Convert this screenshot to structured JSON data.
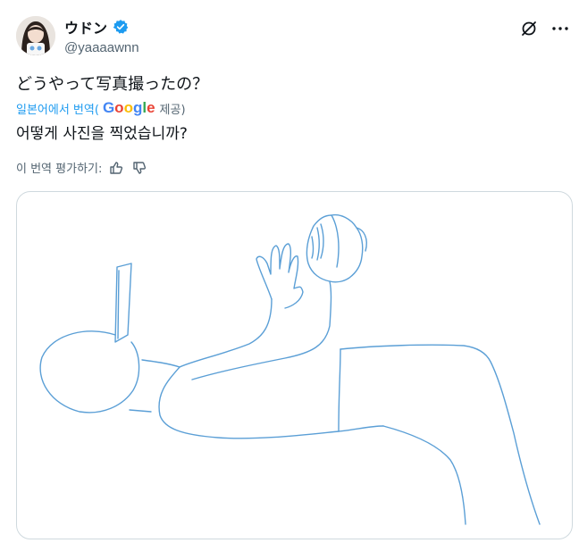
{
  "author": {
    "display_name": "ウドン",
    "handle": "@yaaaawnn",
    "verified": true
  },
  "tweet": {
    "text": "どうやって写真撮ったの？"
  },
  "translation": {
    "prefix": "일본어에서 번역(",
    "google_letters": [
      "G",
      "o",
      "o",
      "g",
      "l",
      "e"
    ],
    "suffix": " 제공)",
    "translated_text": "어떻게 사진을 찍었습니까?"
  },
  "rating": {
    "label": "이 번역 평가하기:"
  },
  "icons": {
    "verified": "verified-badge-icon",
    "grok": "grok-icon",
    "more": "more-icon",
    "thumbs_up": "thumbs-up-icon",
    "thumbs_down": "thumbs-down-icon"
  },
  "colors": {
    "accent": "#1d9bf0",
    "text": "#0f1419",
    "secondary": "#536471",
    "border": "#cfd9de",
    "sketch": "#5b9fd6"
  }
}
